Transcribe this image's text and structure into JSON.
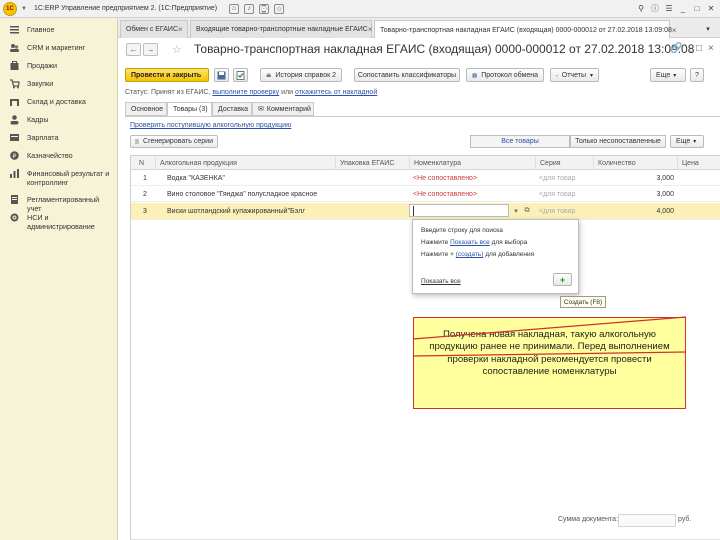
{
  "titlebar": {
    "app_title": "1С:ERP Управление предприятием 2. (1С:Предприятие)"
  },
  "sidebar": {
    "items": [
      {
        "label": "Главное",
        "icon": "menu-icon"
      },
      {
        "label": "CRM и маркетинг",
        "icon": "crm-icon"
      },
      {
        "label": "Продажи",
        "icon": "sales-icon"
      },
      {
        "label": "Закупки",
        "icon": "purchases-icon"
      },
      {
        "label": "Склад и доставка",
        "icon": "warehouse-icon"
      },
      {
        "label": "Кадры",
        "icon": "staff-icon"
      },
      {
        "label": "Зарплата",
        "icon": "salary-icon"
      },
      {
        "label": "Казначейство",
        "icon": "treasury-icon"
      },
      {
        "label": "Финансовый результат и контроллинг",
        "icon": "finance-icon"
      },
      {
        "label": "Регламентированный учет",
        "icon": "accounting-icon"
      },
      {
        "label": "НСИ и администрирование",
        "icon": "admin-icon"
      }
    ]
  },
  "tabs": [
    {
      "label": "Обмен с ЕГАИС"
    },
    {
      "label": "Входящие товарно-транспортные накладные ЕГАИС"
    },
    {
      "label": "Товарно-транспортная накладная ЕГАИС (входящая) 0000-000012 от 27.02.2018 13:09:08"
    }
  ],
  "document": {
    "title": "Товарно-транспортная накладная ЕГАИС (входящая) 0000-000012 от 27.02.2018 13:09:08"
  },
  "toolbar": {
    "post_close": "Провести и закрыть",
    "history": "История справок 2",
    "match": "Сопоставить классификаторы",
    "protocol": "Протокол обмена",
    "reports": "Отчеты",
    "more": "Еще"
  },
  "status": {
    "prefix": "Статус:",
    "text": "Принят из ЕГАИС,",
    "link1": "выполните проверку",
    "or": "или",
    "link2": "откажитесь от накладной"
  },
  "form_tabs": [
    "Основное",
    "Товары (3)",
    "Доставка",
    "Комментарий"
  ],
  "goods": {
    "check_link": "Проверить поступившую алкогольную продукцию",
    "generate_btn": "Сгенерировать серии",
    "filter_all": "Все товары",
    "filter_unmatched": "Только несопоставленные",
    "more": "Еще",
    "columns": [
      "N",
      "Алкогольная продукция",
      "Упаковка ЕГАИС",
      "Номенклатура",
      "Серия",
      "Количество",
      "Цена"
    ],
    "rows": [
      {
        "n": "1",
        "product": "Водка \"КАЗЕНКА\"",
        "pack": "",
        "nomenclature": "<Не сопоставлено>",
        "series": "<для товар",
        "qty": "3,000"
      },
      {
        "n": "2",
        "product": "Вино столовое \"Гянджа\" полусладкое красное",
        "pack": "",
        "nomenclature": "<Не сопоставлено>",
        "series": "<для товар",
        "qty": "3,000"
      },
      {
        "n": "3",
        "product": "Виски шотландский купажированный\"Бэллс ...",
        "pack": "",
        "nomenclature": "",
        "series": "<для товар",
        "qty": "4,000"
      }
    ]
  },
  "popup": {
    "line1": "Введите строку для поиска",
    "press": "Нажмите",
    "show_all_link": "Показать все",
    "for_select": "для выбора",
    "create_link": "(создать)",
    "for_add": "для добавления",
    "show_all_bottom": "Показать все",
    "tooltip": "Создать (F8)"
  },
  "callout": {
    "text": "Получена новая накладная, такую алкогольную продукцию ранее не принимали. Перед выполнением проверки накладной рекомендуется провести сопоставление номенклатуры"
  },
  "footer": {
    "sum_label": "Сумма документа:",
    "currency": "руб."
  }
}
